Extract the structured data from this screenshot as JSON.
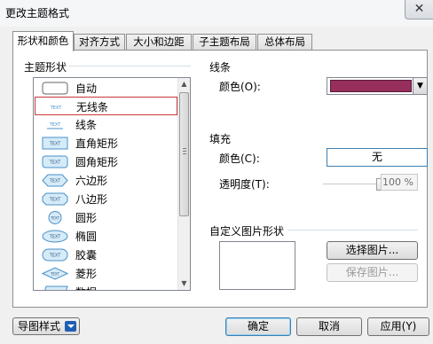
{
  "window": {
    "title": "更改主题格式",
    "close_glyph": "✕"
  },
  "tabs": [
    {
      "label": "形状和颜色",
      "active": true
    },
    {
      "label": "对齐方式",
      "active": false
    },
    {
      "label": "大小和边距",
      "active": false
    },
    {
      "label": "子主题布局",
      "active": false
    },
    {
      "label": "总体布局",
      "active": false
    }
  ],
  "shape_group": {
    "title": "主题形状",
    "selected_index": 1,
    "items": [
      {
        "label": "自动",
        "icon": "rounded-rect-outline-icon"
      },
      {
        "label": "无线条",
        "icon": "text-no-line-icon"
      },
      {
        "label": "线条",
        "icon": "text-underline-icon"
      },
      {
        "label": "直角矩形",
        "icon": "rect-icon"
      },
      {
        "label": "圆角矩形",
        "icon": "rounded-rect-icon"
      },
      {
        "label": "六边形",
        "icon": "hexagon-icon"
      },
      {
        "label": "八边形",
        "icon": "octagon-icon"
      },
      {
        "label": "圆形",
        "icon": "circle-icon"
      },
      {
        "label": "椭圆",
        "icon": "ellipse-icon"
      },
      {
        "label": "胶囊",
        "icon": "capsule-icon"
      },
      {
        "label": "菱形",
        "icon": "diamond-icon"
      },
      {
        "label": "数据",
        "icon": "data-icon"
      }
    ],
    "icon_text": "TEXT"
  },
  "line_group": {
    "title": "线条",
    "color_label": "颜色(O):",
    "color_value": "#962f5c"
  },
  "fill_group": {
    "title": "填充",
    "color_label": "颜色(C):",
    "color_value": "无",
    "transparency_label": "透明度(T):",
    "transparency_value": "100 %",
    "transparency_fraction": 1.0
  },
  "image_group": {
    "title": "自定义图片形状",
    "select_button": "选择图片...",
    "save_button": "保存图片..."
  },
  "footer": {
    "style_button": "导图样式",
    "ok": "确定",
    "cancel": "取消",
    "apply": "应用(Y)"
  },
  "colors": {
    "accent": "#3c7fb1",
    "selection_border": "#c83a3a",
    "shape_fill": "#d6ebf8",
    "shape_stroke": "#4a90c8"
  }
}
